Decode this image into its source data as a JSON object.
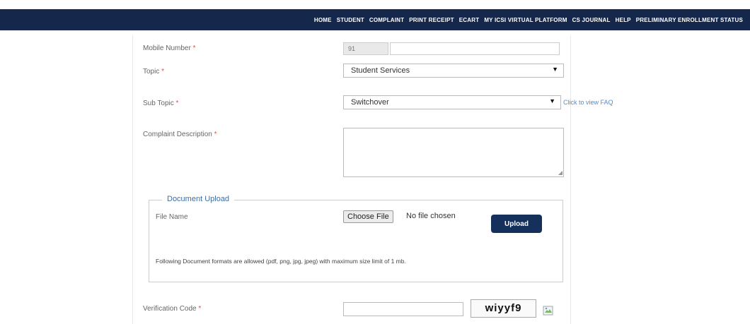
{
  "nav": {
    "items": [
      "HOME",
      "STUDENT",
      "COMPLAINT",
      "PRINT RECEIPT",
      "ECART",
      "MY ICSI VIRTUAL PLATFORM",
      "CS JOURNAL",
      "HELP",
      "PRELIMINARY ENROLLMENT STATUS"
    ],
    "bg_color": "#15284b"
  },
  "form": {
    "mobile": {
      "label": "Mobile Number",
      "required_mark": "*",
      "country_code": "91",
      "value": ""
    },
    "topic": {
      "label": "Topic",
      "required_mark": "*",
      "selected": "Student Services"
    },
    "sub_topic": {
      "label": "Sub Topic",
      "required_mark": "*",
      "selected": "Switchover",
      "faq_link": "Click to view FAQ"
    },
    "complaint": {
      "label": "Complaint Description",
      "required_mark": "*",
      "value": ""
    },
    "upload": {
      "legend": "Document Upload",
      "file_label": "File Name",
      "choose_label": "Choose File",
      "no_file_text": "No file chosen",
      "upload_label": "Upload",
      "formats_note": "Following Document formats are allowed (pdf, png, jpg, jpeg) with maximum size limit of 1 mb."
    },
    "verification": {
      "label": "Verification Code",
      "required_mark": "*",
      "value": "",
      "captcha_text": "wiyyf9"
    }
  },
  "icons": {
    "select_caret": "caret-down-icon",
    "captcha_refresh": "broken-image-icon"
  },
  "colors": {
    "accent": "#15305a",
    "link": "#4a8fd6",
    "required": "#d9534f"
  }
}
